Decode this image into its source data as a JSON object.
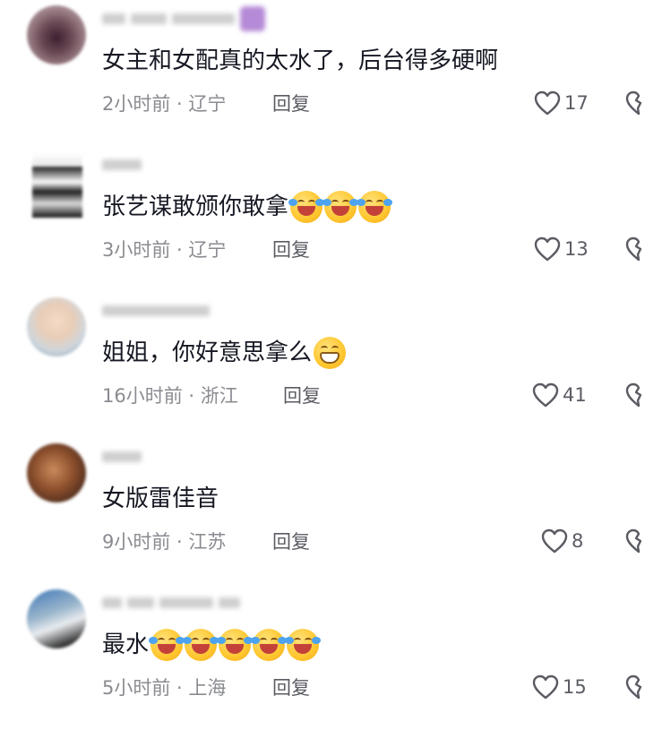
{
  "comments": [
    {
      "text": "女主和女配真的太水了，后台得多硬啊",
      "meta": "2小时前 · 辽宁",
      "reply_label": "回复",
      "likes": "17",
      "emojis": []
    },
    {
      "text": "张艺谋敢颁你敢拿",
      "meta": "3小时前 · 辽宁",
      "reply_label": "回复",
      "likes": "13",
      "emojis": [
        "laugh-cry-emoji",
        "laugh-cry-emoji",
        "laugh-cry-emoji"
      ]
    },
    {
      "text": "姐姐，你好意思拿么",
      "meta": "16小时前 · 浙江",
      "reply_label": "回复",
      "likes": "41",
      "emojis": [
        "grin-emoji"
      ]
    },
    {
      "text": "女版雷佳音",
      "meta": "9小时前 · 江苏",
      "reply_label": "回复",
      "likes": "8",
      "emojis": []
    },
    {
      "text": "最水",
      "meta": "5小时前 · 上海",
      "reply_label": "回复",
      "likes": "15",
      "emojis": [
        "laugh-cry-emoji",
        "laugh-cry-emoji",
        "laugh-cry-emoji",
        "laugh-cry-emoji",
        "laugh-cry-emoji"
      ]
    }
  ],
  "icons": {
    "like": "heart-outline-icon",
    "dislike": "broken-heart-outline-icon"
  },
  "colors": {
    "text": "#161823",
    "meta": "#8a8b91",
    "icon": "#5b5c63"
  }
}
